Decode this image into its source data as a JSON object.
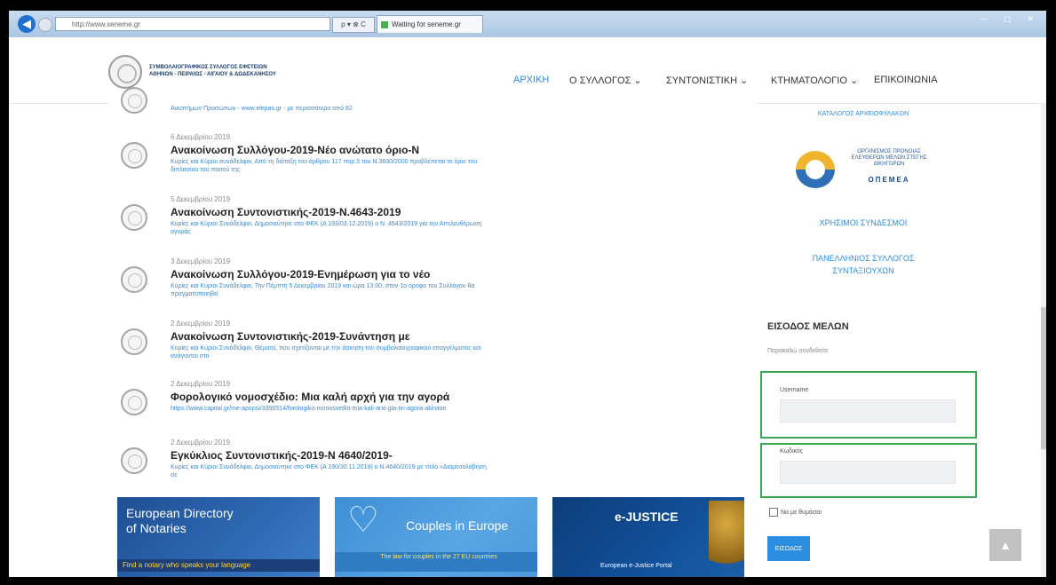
{
  "browser": {
    "address": "http://www.seneme.gr",
    "address_tools": "ρ ▾ ⊗ C",
    "tab_title": "Waiting for seneme.gr",
    "window_controls": "— ◻ ✕"
  },
  "header": {
    "org_name_line1": "ΣΥΜΒΟΛΑΙΟΓΡΑΦΙΚΟΣ ΣΥΛΛΟΓΟΣ ΕΦΕΤΕΙΩΝ",
    "org_name_line2": "ΑΘΗΝΩΝ - ΠΕΙΡΑΙΩΣ - ΑΙΓΑΙΟΥ & ΔΩΔΕΚΑΝΗΣΟΥ",
    "nav": [
      {
        "label": "ΑΡΧΙΚΗ",
        "active": true
      },
      {
        "label": "Ο ΣΥΛΛΟΓΟΣ ⌄",
        "active": false
      },
      {
        "label": "ΣΥΝΤΟΝΙΣΤΙΚΗ ⌄",
        "active": false
      },
      {
        "label": "ΚΤΗΜΑΤΟΛΟΓΙΟ ⌄",
        "active": false
      },
      {
        "label": "ΕΠΙΚΟΙΝΩΝΙΑ",
        "active": false
      }
    ]
  },
  "cut_post_text": "Ανεστήμων Προσώπων - www.elepas.gr - με περισσότερα από 82",
  "posts": [
    {
      "date": "6 Δεκεμβρίου 2019",
      "title": "Ανακοίνωση Συλλόγου-2019-Νέο ανώτατο όριο-Ν",
      "excerpt": "Κυρίες και Κύριοι συνάδελφοι, Από τη διάταξη του άρθρου 117 παρ.5 του Ν.3830/2000 προβλέπεται το όριο του διπλασίου του ποσού της"
    },
    {
      "date": "5 Δεκεμβρίου 2019",
      "title": "Ανακοίνωση Συντονιστικής-2019-Ν.4643-2019",
      "excerpt": "Κυρίες και Κύριοι Συνάδελφοι, Δημοσιεύτηκε στο ΦΕΚ (Α 193/03.12.2019) ο Ν. 4643/2019 για την Απελευθέρωση αγοράς"
    },
    {
      "date": "3 Δεκεμβρίου 2019",
      "title": "Ανακοίνωση Συλλόγου-2019-Ενημέρωση για το νέο",
      "excerpt": "Κυρίες και Κύριοι Συνάδελφοι, Την Πέμπτη 5 Δεκεμβρίου 2019 και ώρα 13.00, στον 1ο όροφο του Συλλόγου θα πραγματοποιηθεί"
    },
    {
      "date": "2 Δεκεμβρίου 2019",
      "title": "Ανακοίνωση Συντονιστικής-2019-Συνάντηση με",
      "excerpt": "Κυρίες και Κύριοι Συνάδελφοι, Θέματα, που σχετίζονται με την άσκηση του συμβολαιογραφικού επαγγέλματος και ανάγονται στο"
    },
    {
      "date": "2 Δεκεμβρίου 2019",
      "title": "Φορολογικό νομοσχέδιο: Μια καλή αρχή για την αγορά",
      "excerpt": "https://www.capital.gr/me-apopsi/3396514/forologiko-nomosxedio-mia-kali-arxi-gia-tin-agora-akiniton"
    },
    {
      "date": "2 Δεκεμβρίου 2019",
      "title": "Εγκύκλιος Συντονιστικής-2019-Ν 4640/2019-",
      "excerpt": "Κυρίες και Κύριοι Συνάδελφοι, Δημοσιεύτηκε στο ΦΕΚ (Α 190/30.11.2019) ο Ν.4640/2019 με τίτλο «Διαμεσολάβηση σε"
    }
  ],
  "banners": {
    "b1_title": "European Directory",
    "b1_sub": "of Notaries",
    "b1_stripe": "Find a notary who speaks your language",
    "b2_title": "Couples in Europe",
    "b2_stripe": "The law for couples in the 27 EU countries",
    "b3_title": "e-JUSTICE",
    "b3_sub": "European e-Justice Portal"
  },
  "sidebar": {
    "catalog_text": "ΚΑΤΑΛΟΓΟΣ ΑΡΧΕΙΟΦΥΛΑΚΩΝ",
    "opeka_text": "ΟΡΓΑΝΙΣΜΟΣ ΠΡΟΝΟΙΑΣ ΕΛΕΥΘΕΡΩΝ ΜΕΛΩΝ ΣΤΕΓΗΣ ΔΙΚΗΓΟΡΩΝ",
    "opeka_brand": "ΟΠΕΜΕΑ",
    "useful_links": "ΧΡΗΣΙΜΟΙ ΣΥΝΔΕΣΜΟΙ",
    "pension_line1": "ΠΑΝΕΛΛΗΝΙΟΣ ΣΥΛΛΟΓΟΣ",
    "pension_line2": "ΣΥΝΤΑΞΙΟΥΧΩΝ",
    "login_title": "ΕΙΣΟΔΟΣ ΜΕΛΩΝ",
    "login_hint": "Παρακαλώ συνδεθείτε",
    "username_label": "Username",
    "password_label": "Κωδικός",
    "remember_label": "Να με θυμάσαι",
    "submit_label": "ΕΙΣΟΔΟΣ"
  },
  "to_top_icon": "▲",
  "colors": {
    "accent": "#2c8ee0",
    "highlight_border": "#39a852"
  }
}
